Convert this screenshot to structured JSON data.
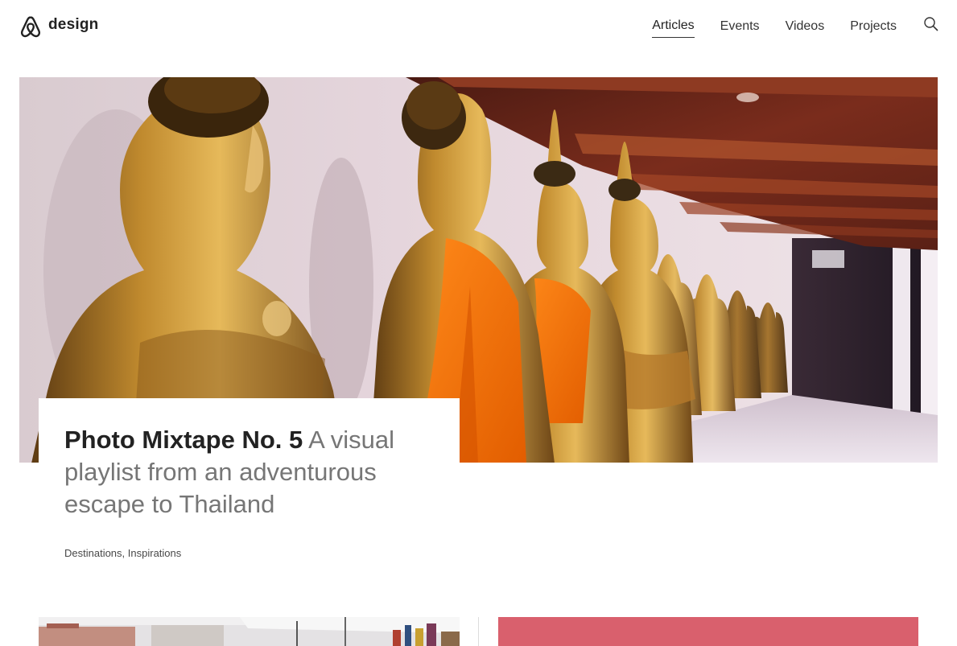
{
  "header": {
    "brand_name": "design",
    "logo_icon": "airbnb-belo-icon",
    "nav": [
      {
        "label": "Articles",
        "active": true
      },
      {
        "label": "Events",
        "active": false
      },
      {
        "label": "Videos",
        "active": false
      },
      {
        "label": "Projects",
        "active": false
      }
    ],
    "search_icon": "search-icon"
  },
  "hero": {
    "title_strong": "Photo Mixtape No. 5",
    "title_rest": "A visual playlist from an adventurous escape to Thailand",
    "tags": [
      "Destinations",
      "Inspirations"
    ],
    "tag_separator": ", "
  },
  "colors": {
    "accent_card": "#d9606d",
    "text_primary": "#222222",
    "text_secondary": "#767676"
  }
}
